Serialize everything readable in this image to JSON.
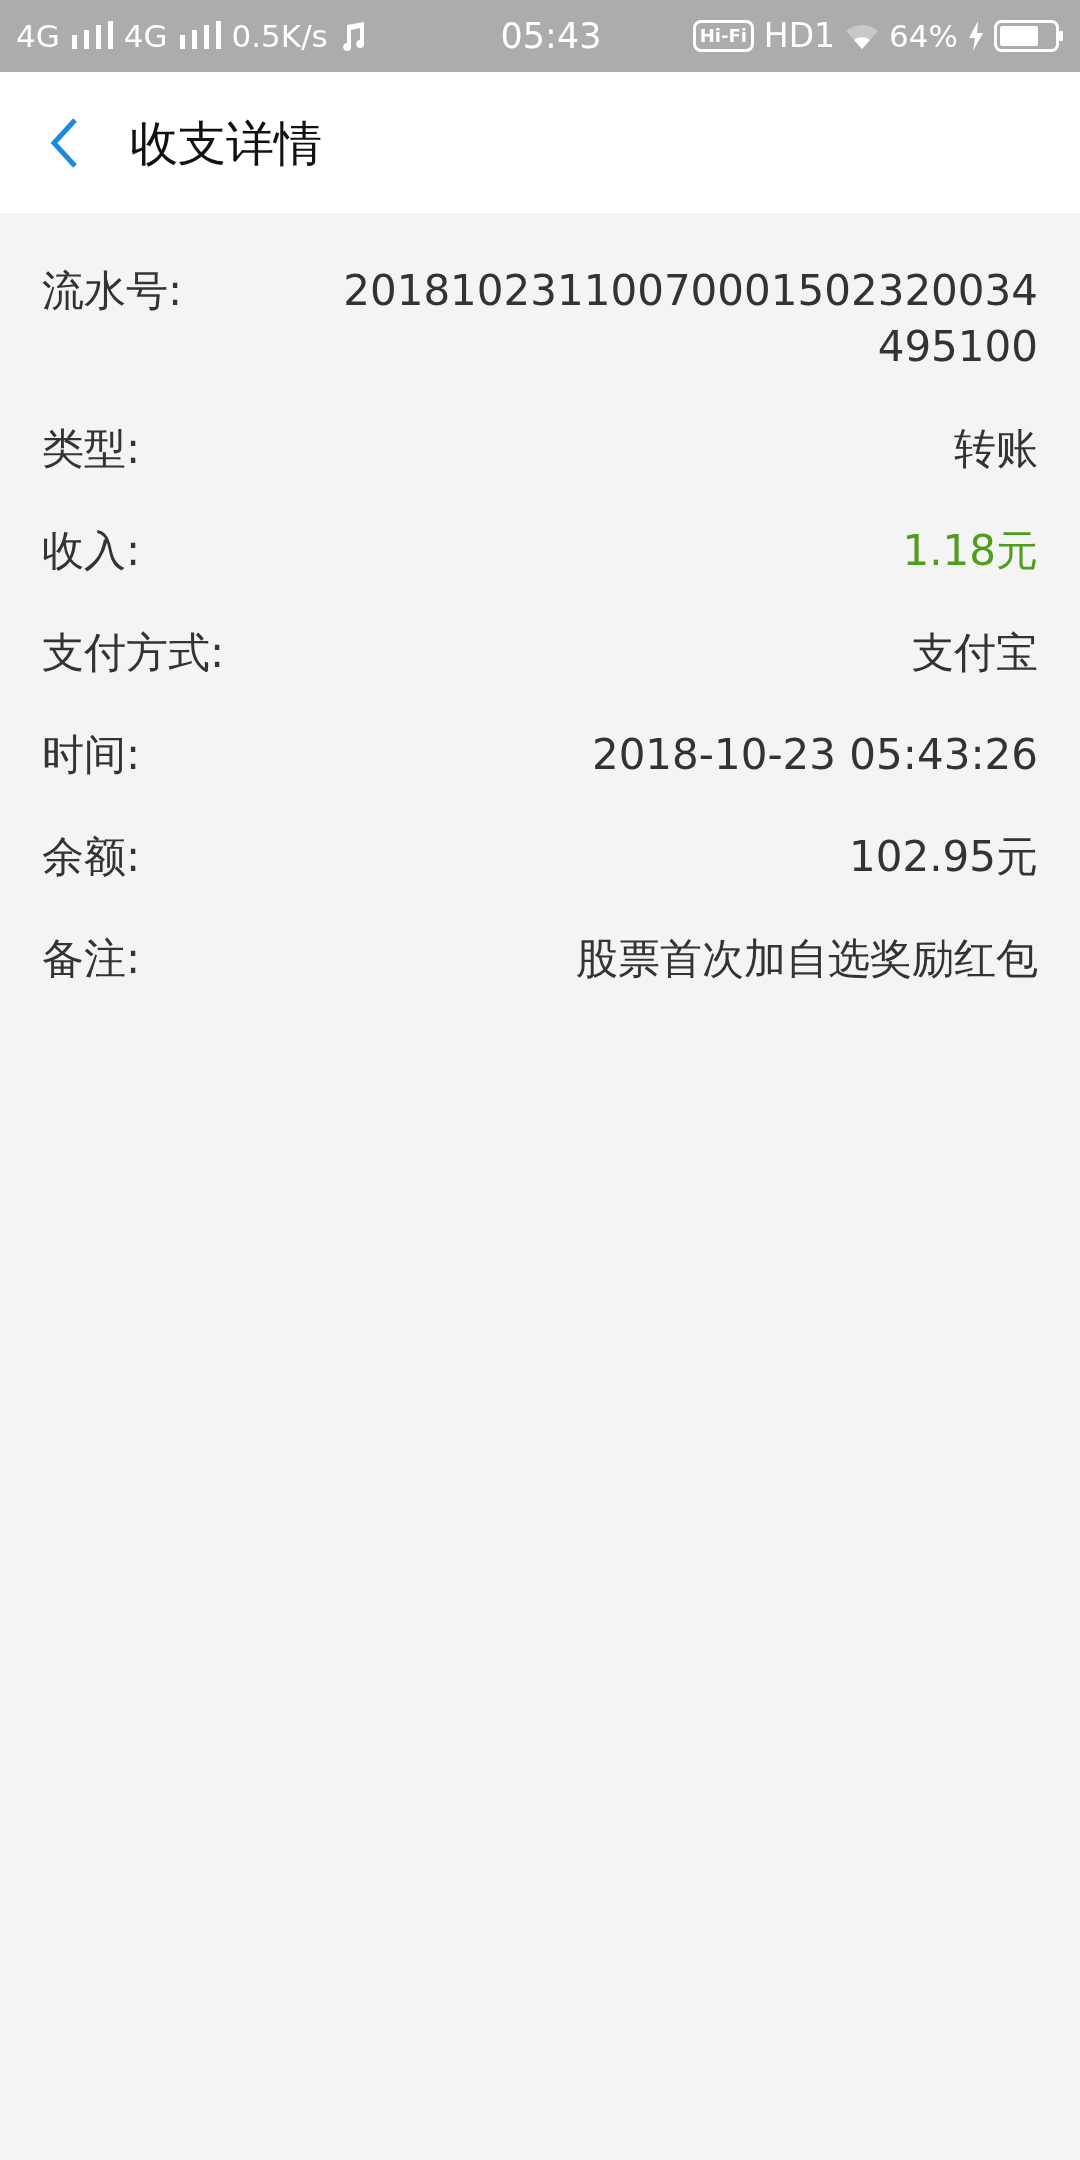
{
  "status_bar": {
    "network_1": "4G",
    "network_2": "4G",
    "speed": "0.5K/s",
    "time": "05:43",
    "hifi": "Hi-Fi",
    "hd": "HD1",
    "battery": "64%"
  },
  "header": {
    "title": "收支详情"
  },
  "rows": [
    {
      "label": "流水号:",
      "value": "20181023110070001502320034495100",
      "kind": "plain"
    },
    {
      "label": "类型:",
      "value": "转账",
      "kind": "plain"
    },
    {
      "label": "收入:",
      "value": "1.18元",
      "kind": "income"
    },
    {
      "label": "支付方式:",
      "value": "支付宝",
      "kind": "plain"
    },
    {
      "label": "时间:",
      "value": "2018-10-23 05:43:26",
      "kind": "plain"
    },
    {
      "label": "余额:",
      "value": "102.95元",
      "kind": "plain"
    },
    {
      "label": "备注:",
      "value": "股票首次加自选奖励红包",
      "kind": "plain"
    }
  ]
}
